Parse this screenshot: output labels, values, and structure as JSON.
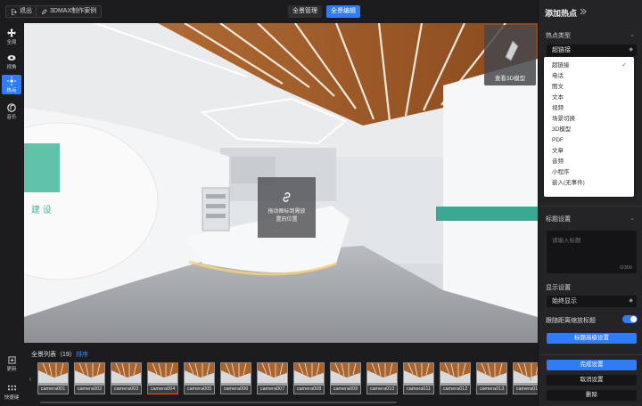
{
  "topbar": {
    "back_label": "退出",
    "project_label": "3DMAX制作案例",
    "tabs": [
      {
        "label": "全景管理",
        "active": false
      },
      {
        "label": "全景编辑",
        "active": true
      }
    ]
  },
  "left_toolbar": {
    "items": [
      {
        "label": "全局",
        "icon": "move-icon",
        "active": false
      },
      {
        "label": "视角",
        "icon": "eye-icon",
        "active": false
      },
      {
        "label": "热点",
        "icon": "hotspot-icon",
        "active": true
      },
      {
        "label": "音乐",
        "icon": "music-icon",
        "active": false
      }
    ],
    "footer": [
      {
        "label": "更新",
        "icon": "update-icon"
      },
      {
        "label": "快捷键",
        "icon": "keyboard-icon"
      }
    ]
  },
  "viewport": {
    "hotspot_text_line1": "拖动图标到需放",
    "hotspot_text_line2": "置的位置",
    "model_label": "查看3D模型",
    "wall_text": "建 设"
  },
  "panorama_list": {
    "title": "全景列表（19）",
    "sort_label": "排序",
    "selected_index": 3,
    "items": [
      "camera001",
      "camera002",
      "camera003",
      "camera004",
      "camera005",
      "camera006",
      "camera007",
      "camera008",
      "camera009",
      "camera010",
      "camera011",
      "camera012",
      "camera013",
      "camera014"
    ]
  },
  "panel": {
    "title": "添加热点",
    "hotspot_type_label": "热点类型",
    "hotspot_type_value": "超链接",
    "type_options": [
      "超链接",
      "电话",
      "图文",
      "文本",
      "视频",
      "场景切换",
      "3D模型",
      "PDF",
      "文章",
      "音频",
      "小程序",
      "嵌入(无事件)"
    ],
    "selected_type": "超链接",
    "title_settings_label": "标题设置",
    "title_placeholder": "请输入标题",
    "title_counter": "0/300",
    "display_settings_label": "显示设置",
    "display_value": "始终显示",
    "follow_zoom_label": "跟随距离缩放标题",
    "follow_zoom_on": true,
    "advanced_button": "标题高级设置",
    "done_button": "完成设置",
    "cancel_button": "取消设置",
    "delete_button": "删除"
  },
  "colors": {
    "accent": "#2f7cf6",
    "bg": "#1a1a1c",
    "panel": "#242427"
  }
}
